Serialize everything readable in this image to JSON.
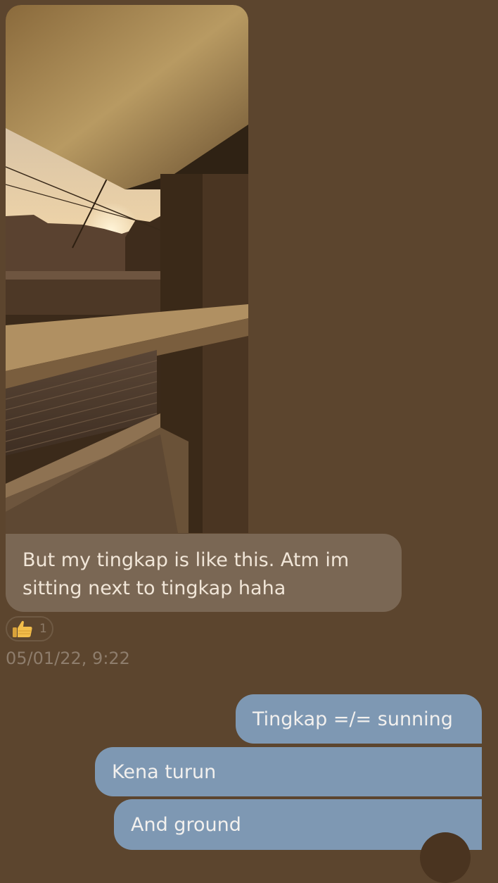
{
  "messages": {
    "received_text": "But my tingkap is like this. Atm im sitting next to tingkap haha",
    "reaction": {
      "icon": "thumbs-up-icon",
      "count": "1"
    },
    "timestamp": "05/01/22, 9:22",
    "sent": [
      {
        "text": "Tingkap =/= sunning"
      },
      {
        "text": "Kena turun"
      },
      {
        "text": "And ground"
      }
    ]
  },
  "colors": {
    "background": "#5c452e",
    "received_bubble": "#7a6754",
    "sent_bubble": "#7e98b3"
  }
}
